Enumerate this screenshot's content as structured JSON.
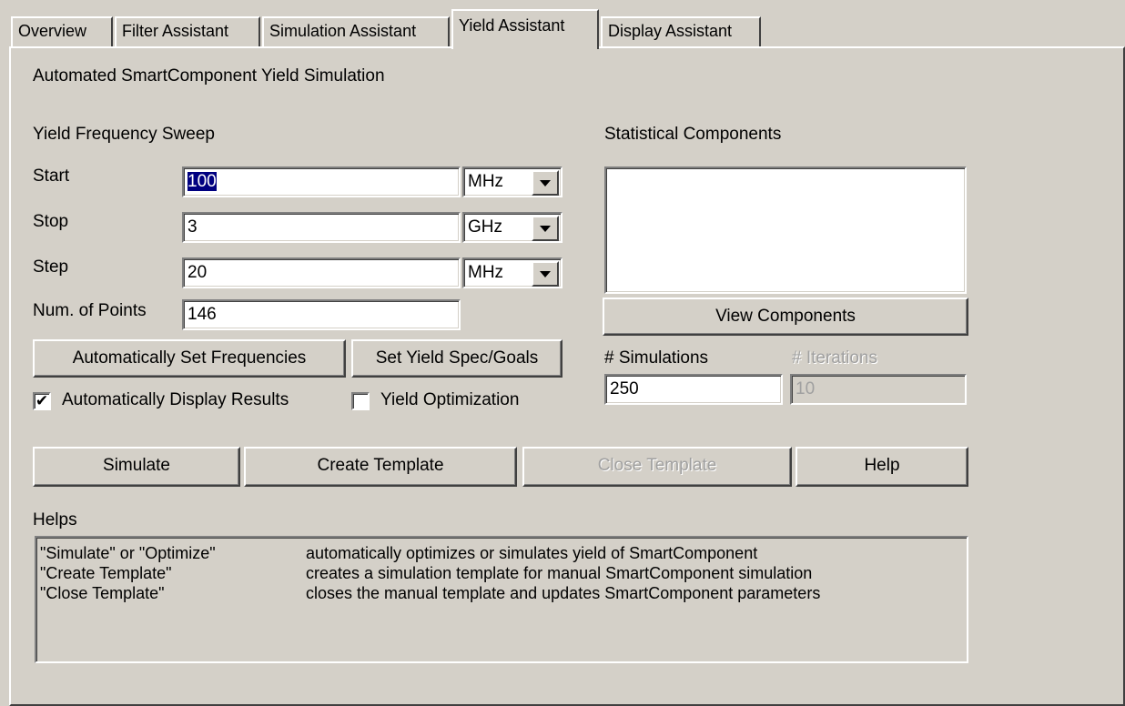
{
  "tabs": [
    {
      "label": "Overview"
    },
    {
      "label": "Filter Assistant"
    },
    {
      "label": "Simulation Assistant"
    },
    {
      "label": "Yield Assistant"
    },
    {
      "label": "Display Assistant"
    }
  ],
  "page": {
    "heading": "Automated SmartComponent Yield Simulation",
    "sweep_heading": "Yield Frequency Sweep",
    "stat_heading": "Statistical Components"
  },
  "sweep": {
    "start_label": "Start",
    "start_value": "100",
    "start_unit": "MHz",
    "stop_label": "Stop",
    "stop_value": "3",
    "stop_unit": "GHz",
    "step_label": "Step",
    "step_value": "20",
    "step_unit": "MHz",
    "points_label": "Num. of Points",
    "points_value": "146"
  },
  "buttons": {
    "auto_freq": "Automatically Set Frequencies",
    "set_yield_spec": "Set Yield Spec/Goals",
    "view_components": "View Components",
    "simulate": "Simulate",
    "create_template": "Create Template",
    "close_template": "Close Template",
    "help": "Help"
  },
  "options": {
    "auto_display_label": "Automatically Display Results",
    "auto_display_checked": "✔",
    "yield_opt_label": "Yield Optimization",
    "yield_opt_checked": ""
  },
  "sim": {
    "simulations_label": "# Simulations",
    "simulations_value": "250",
    "iterations_label": "# Iterations",
    "iterations_value": "10"
  },
  "helps": {
    "label": "Helps",
    "rows": [
      {
        "key": "\"Simulate\" or \"Optimize\"",
        "desc": "automatically optimizes or simulates yield of SmartComponent"
      },
      {
        "key": "\"Create Template\"",
        "desc": "creates a simulation template for manual SmartComponent simulation"
      },
      {
        "key": "\"Close Template\"",
        "desc": "closes the manual template and updates SmartComponent parameters"
      }
    ]
  }
}
